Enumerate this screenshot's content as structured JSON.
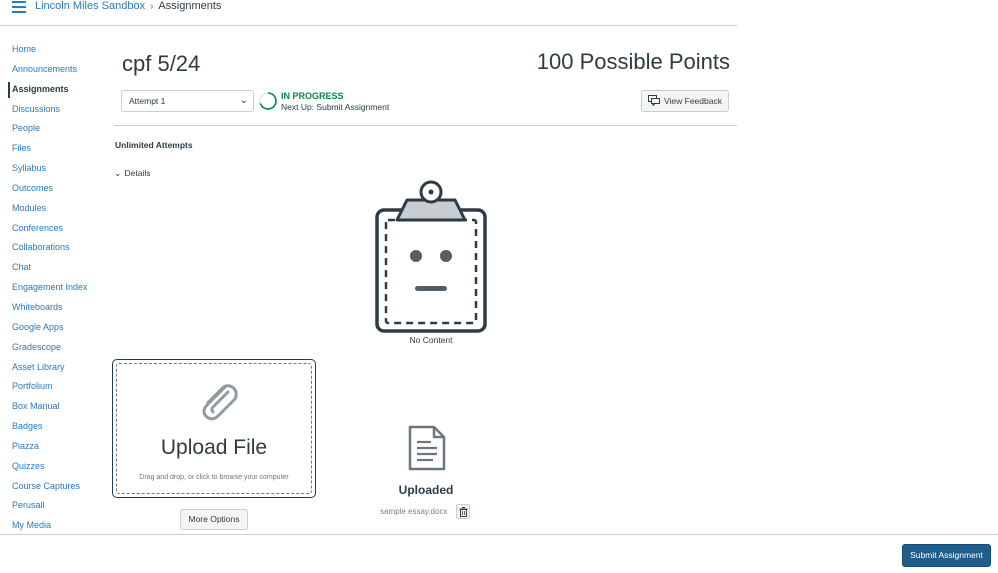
{
  "breadcrumb": {
    "course": "Lincoln Miles Sandbox",
    "separator": "›",
    "current": "Assignments"
  },
  "nav": {
    "items": [
      {
        "label": "Home",
        "active": false
      },
      {
        "label": "Announcements",
        "active": false
      },
      {
        "label": "Assignments",
        "active": true
      },
      {
        "label": "Discussions",
        "active": false
      },
      {
        "label": "People",
        "active": false
      },
      {
        "label": "Files",
        "active": false
      },
      {
        "label": "Syllabus",
        "active": false
      },
      {
        "label": "Outcomes",
        "active": false
      },
      {
        "label": "Modules",
        "active": false
      },
      {
        "label": "Conferences",
        "active": false
      },
      {
        "label": "Collaborations",
        "active": false
      },
      {
        "label": "Chat",
        "active": false
      },
      {
        "label": "Engagement Index",
        "active": false
      },
      {
        "label": "Whiteboards",
        "active": false
      },
      {
        "label": "Google Apps",
        "active": false
      },
      {
        "label": "Gradescope",
        "active": false
      },
      {
        "label": "Asset Library",
        "active": false
      },
      {
        "label": "Portfolium",
        "active": false
      },
      {
        "label": "Box Manual",
        "active": false
      },
      {
        "label": "Badges",
        "active": false
      },
      {
        "label": "Piazza",
        "active": false
      },
      {
        "label": "Quizzes",
        "active": false
      },
      {
        "label": "Course Captures",
        "active": false
      },
      {
        "label": "Perusall",
        "active": false
      },
      {
        "label": "My Media",
        "active": false
      }
    ]
  },
  "assignment": {
    "title": "cpf 5/24",
    "points": "100 Possible Points",
    "attempt_select": "Attempt 1",
    "status": "IN PROGRESS",
    "next_up": "Next Up: Submit Assignment",
    "view_feedback": "View Feedback",
    "attempts_info": "Unlimited Attempts",
    "details_toggle": "Details"
  },
  "empty_state": {
    "label": "No Content"
  },
  "upload": {
    "title": "Upload File",
    "hint": "Drag and drop, or click to browse your computer",
    "more_options": "More Options"
  },
  "uploaded": {
    "label": "Uploaded",
    "file_name": "sample essay.docx"
  },
  "footer": {
    "submit_label": "Submit Assignment"
  },
  "colors": {
    "link": "#2b7abc",
    "text": "#2d3b45",
    "status_green": "#0b874b",
    "submit_bg": "#1f5e8c"
  }
}
